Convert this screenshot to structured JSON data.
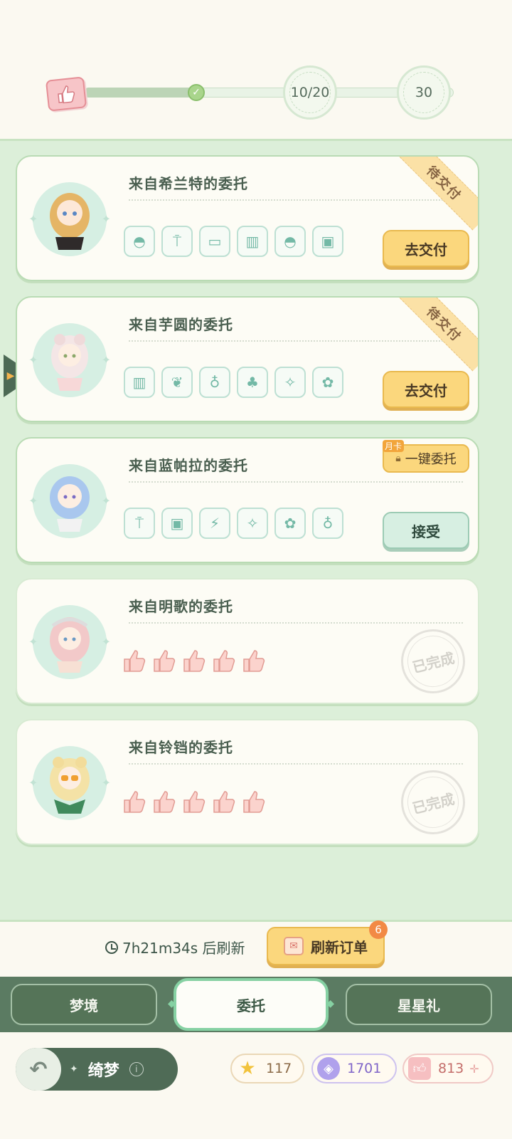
{
  "progress": {
    "value": 10,
    "max": 20,
    "milestone_1": "10/20",
    "milestone_2": "30"
  },
  "orders": [
    {
      "title": "来自希兰特的委托",
      "status_ribbon": "待交付",
      "button": "去交付",
      "items": [
        "round-table-icon",
        "floor-lamp-icon",
        "sofa-icon",
        "cabinet-icon",
        "round-table-icon",
        "tv-icon"
      ]
    },
    {
      "title": "来自芋圆的委托",
      "status_ribbon": "待交付",
      "button": "去交付",
      "items": [
        "cabinet-icon",
        "grass-icon",
        "vacuum-icon",
        "tree-icon",
        "garland-icon",
        "bouquet-icon"
      ]
    },
    {
      "title": "来自蓝帕拉的委托",
      "oneclick_tag": "月卡",
      "oneclick_label": "一键委托",
      "button": "接受",
      "items": [
        "floor-lamp-icon",
        "tv-icon",
        "monitor-icon",
        "garland-icon",
        "bouquet-icon",
        "vacuum-icon"
      ]
    },
    {
      "title": "来自明歌的委托",
      "stamp": "已完成",
      "rating": 5
    },
    {
      "title": "来自铃铛的委托",
      "stamp": "已完成",
      "rating": 5
    }
  ],
  "refresh": {
    "timer": "7h21m34s 后刷新",
    "button": "刷新订单",
    "badge": "6"
  },
  "tabs": [
    "梦境",
    "委托",
    "星星礼"
  ],
  "active_tab": "委托",
  "bottom": {
    "title": "绮梦",
    "stars": "117",
    "gems": "1701",
    "likes": "813"
  },
  "colors": {
    "accent_yellow": "#fbd77d",
    "panel_green": "#dcefd9",
    "tab_green": "#5b7b62"
  }
}
